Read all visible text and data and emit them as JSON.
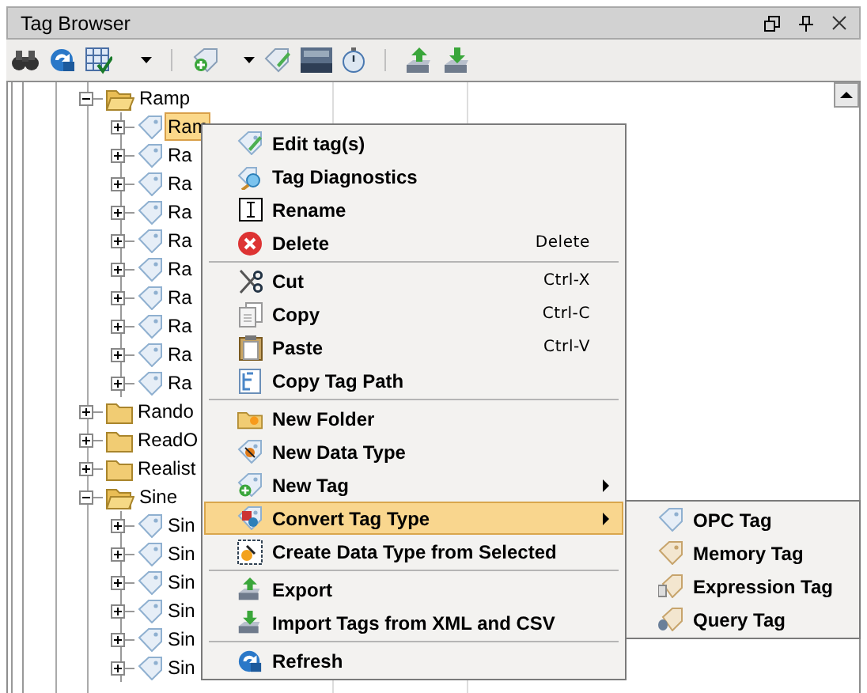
{
  "panel": {
    "title": "Tag Browser"
  },
  "tree": [
    {
      "kind": "folder",
      "label": "Ramp",
      "expanded": true,
      "selected": false,
      "children": [
        {
          "kind": "tag",
          "label": "Ram",
          "expanded": false,
          "selected": true
        },
        {
          "kind": "tag",
          "label": "Ra",
          "expanded": false,
          "selected": false
        },
        {
          "kind": "tag",
          "label": "Ra",
          "expanded": false,
          "selected": false
        },
        {
          "kind": "tag",
          "label": "Ra",
          "expanded": false,
          "selected": false
        },
        {
          "kind": "tag",
          "label": "Ra",
          "expanded": false,
          "selected": false
        },
        {
          "kind": "tag",
          "label": "Ra",
          "expanded": false,
          "selected": false
        },
        {
          "kind": "tag",
          "label": "Ra",
          "expanded": false,
          "selected": false
        },
        {
          "kind": "tag",
          "label": "Ra",
          "expanded": false,
          "selected": false
        },
        {
          "kind": "tag",
          "label": "Ra",
          "expanded": false,
          "selected": false
        },
        {
          "kind": "tag",
          "label": "Ra",
          "expanded": false,
          "selected": false
        }
      ]
    },
    {
      "kind": "folder",
      "label": "Rando",
      "expanded": false,
      "selected": false
    },
    {
      "kind": "folder",
      "label": "ReadO",
      "expanded": false,
      "selected": false
    },
    {
      "kind": "folder",
      "label": "Realist",
      "expanded": false,
      "selected": false
    },
    {
      "kind": "folder",
      "label": "Sine",
      "expanded": true,
      "selected": false,
      "children": [
        {
          "kind": "tag",
          "label": "Sin",
          "expanded": false,
          "selected": false
        },
        {
          "kind": "tag",
          "label": "Sin",
          "expanded": false,
          "selected": false
        },
        {
          "kind": "tag",
          "label": "Sin",
          "expanded": false,
          "selected": false
        },
        {
          "kind": "tag",
          "label": "Sin",
          "expanded": false,
          "selected": false
        },
        {
          "kind": "tag",
          "label": "Sin",
          "expanded": false,
          "selected": false
        },
        {
          "kind": "tag",
          "label": "Sin",
          "expanded": false,
          "selected": false
        }
      ]
    }
  ],
  "context_menu": [
    {
      "kind": "item",
      "label": "Edit tag(s)",
      "selected": false
    },
    {
      "kind": "item",
      "label": "Tag Diagnostics",
      "selected": false
    },
    {
      "kind": "item",
      "label": "Rename",
      "selected": false
    },
    {
      "kind": "item",
      "label": "Delete",
      "shortcut": "Delete",
      "selected": false
    },
    {
      "kind": "separator"
    },
    {
      "kind": "item",
      "label": "Cut",
      "shortcut": "Ctrl-X",
      "selected": false
    },
    {
      "kind": "item",
      "label": "Copy",
      "shortcut": "Ctrl-C",
      "selected": false
    },
    {
      "kind": "item",
      "label": "Paste",
      "shortcut": "Ctrl-V",
      "selected": false
    },
    {
      "kind": "item",
      "label": "Copy Tag Path",
      "selected": false
    },
    {
      "kind": "separator"
    },
    {
      "kind": "item",
      "label": "New Folder",
      "selected": false
    },
    {
      "kind": "item",
      "label": "New Data Type",
      "selected": false
    },
    {
      "kind": "item",
      "label": "New Tag",
      "submenu": true,
      "selected": false
    },
    {
      "kind": "item",
      "label": "Convert Tag Type",
      "submenu": true,
      "selected": true
    },
    {
      "kind": "item",
      "label": "Create Data Type from Selected",
      "selected": false
    },
    {
      "kind": "separator"
    },
    {
      "kind": "item",
      "label": "Export",
      "selected": false
    },
    {
      "kind": "item",
      "label": "Import Tags from XML and CSV",
      "selected": false
    },
    {
      "kind": "separator"
    },
    {
      "kind": "item",
      "label": "Refresh",
      "selected": false
    }
  ],
  "submenu": [
    {
      "kind": "item",
      "label": "OPC Tag",
      "selected": false
    },
    {
      "kind": "item",
      "label": "Memory Tag",
      "selected": false
    },
    {
      "kind": "item",
      "label": "Expression Tag",
      "selected": false
    },
    {
      "kind": "item",
      "label": "Query Tag",
      "selected": false
    }
  ]
}
